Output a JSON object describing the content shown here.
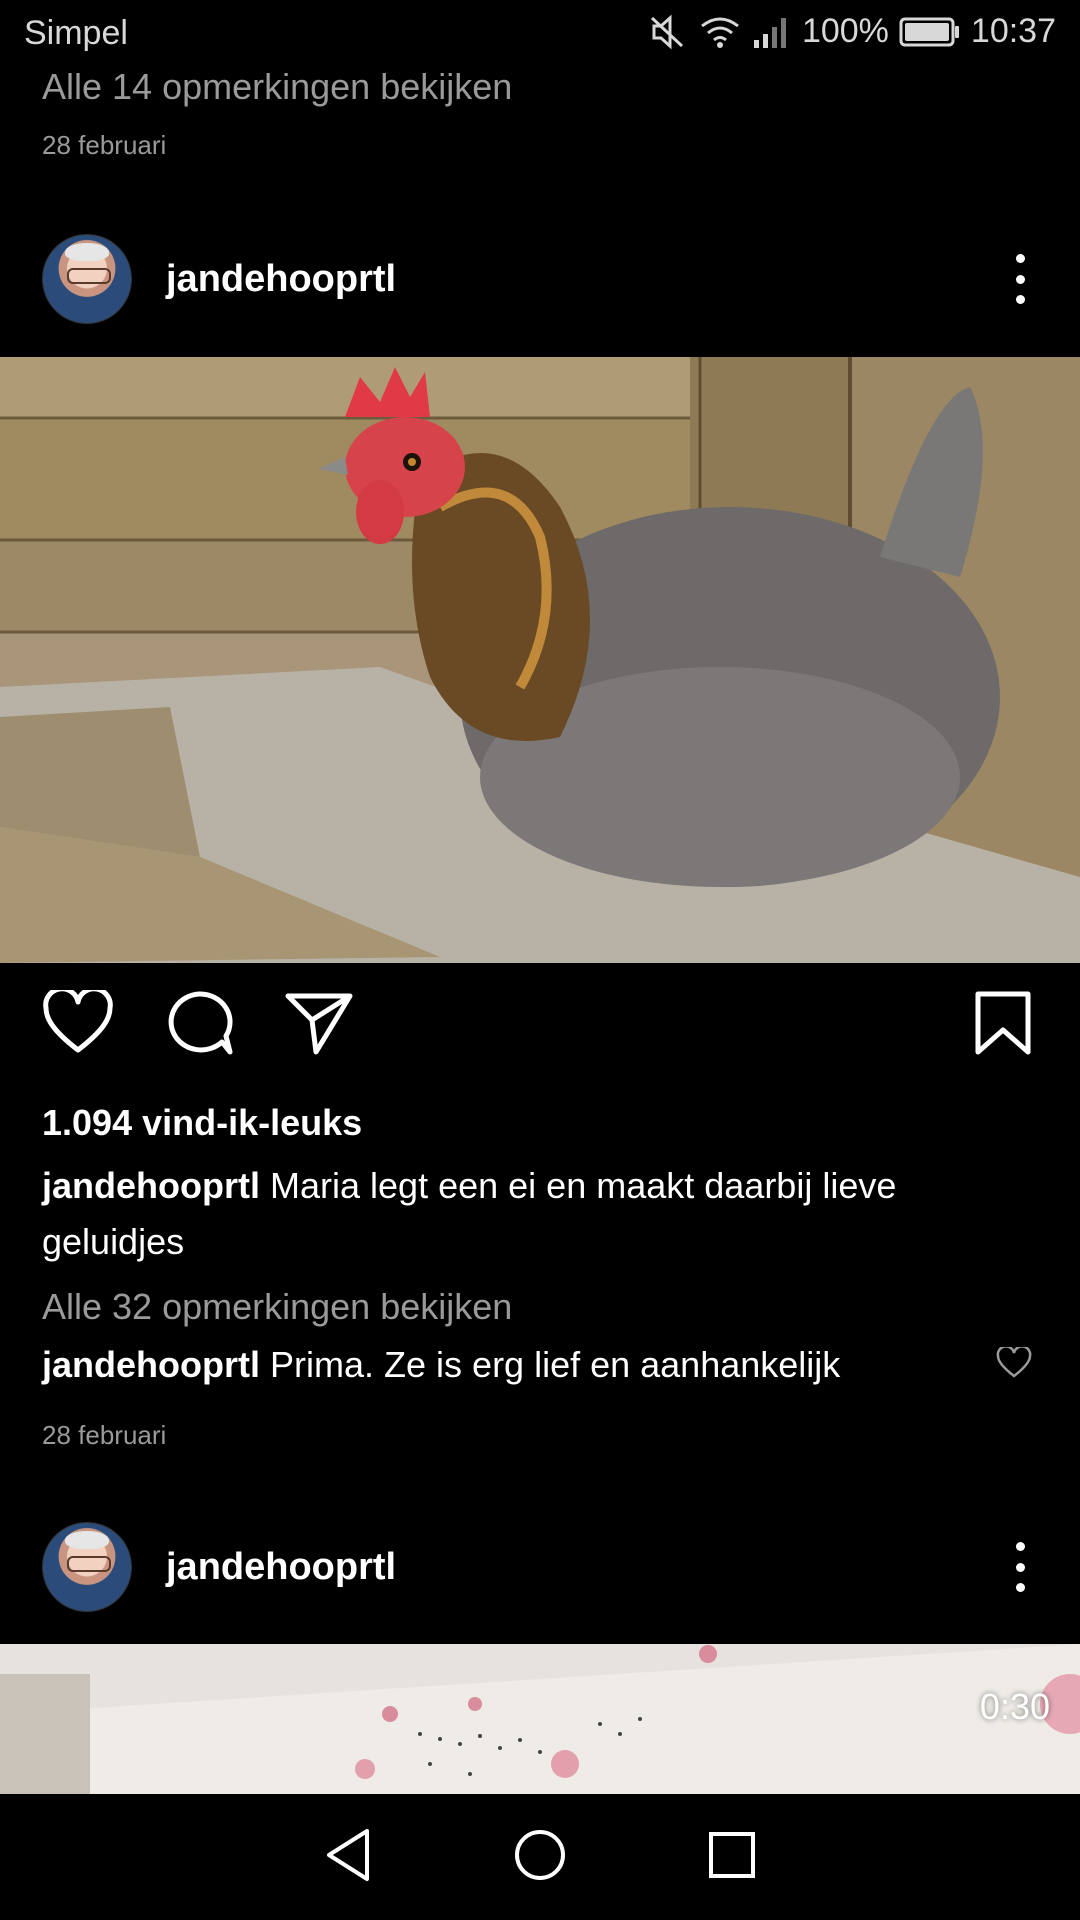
{
  "status_bar": {
    "carrier": "Simpel",
    "battery": "100%",
    "time": "10:37",
    "icons": [
      "mute-icon",
      "wifi-icon",
      "signal-icon",
      "battery-icon"
    ]
  },
  "previous_post": {
    "view_comments": "Alle 14 opmerkingen bekijken",
    "date": "28 februari"
  },
  "post": {
    "username": "jandehooprtl",
    "likes": "1.094 vind-ik-leuks",
    "caption_user": "jandehooprtl",
    "caption_text": "Maria legt een ei en maakt daarbij lieve geluidjes",
    "view_comments": "Alle 32 opmerkingen bekijken",
    "comment_user": "jandehooprtl",
    "comment_text": "Prima. Ze is erg lief en aanhankelijk",
    "date": "28 februari"
  },
  "next_post": {
    "username": "jandehooprtl",
    "video_duration": "0:30"
  },
  "colors": {
    "background": "#000000",
    "muted_text": "#9a9a9a",
    "text": "#ffffff"
  }
}
